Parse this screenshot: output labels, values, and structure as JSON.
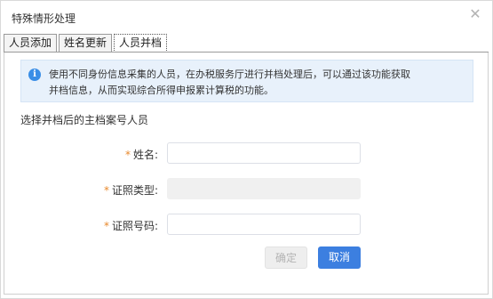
{
  "dialog": {
    "title": "特殊情形处理",
    "close_icon": "close-icon"
  },
  "tabs": [
    {
      "label": "人员添加",
      "active": false
    },
    {
      "label": "姓名更新",
      "active": false
    },
    {
      "label": "人员并档",
      "active": true
    }
  ],
  "notice": {
    "icon": "info-icon",
    "line1": "使用不同身份信息采集的人员，在办税服务厅进行并档处理后，可以通过该功能获取",
    "line2": "并档信息，从而实现综合所得申报累计算税的功能。"
  },
  "section_title": "选择并档后的主档案号人员",
  "form": {
    "name_label": "姓名:",
    "name_value": "",
    "id_type_label": "证照类型:",
    "id_type_value": "",
    "id_number_label": "证照号码:",
    "id_number_value": "",
    "required_mark": "*"
  },
  "buttons": {
    "confirm": "确定",
    "cancel": "取消"
  },
  "colors": {
    "primary": "#3c7fe0",
    "required": "#e8882b",
    "notice_bg": "#e8f1fb"
  }
}
